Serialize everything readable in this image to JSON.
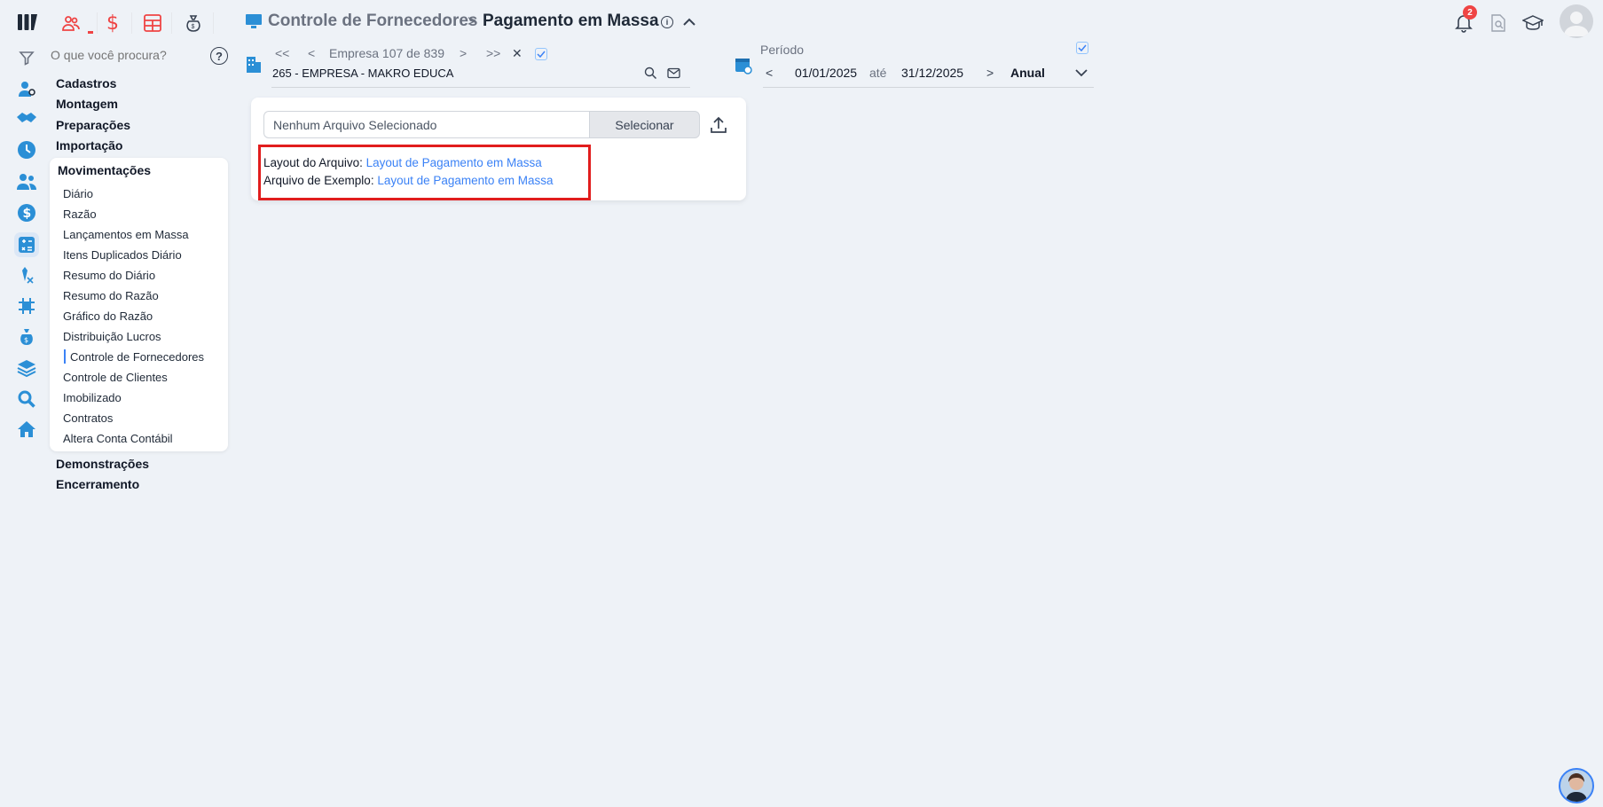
{
  "header": {
    "breadcrumb_parent": "Controle de Fornecedores",
    "breadcrumb_separator": ">",
    "page_title": "Pagamento em Massa"
  },
  "search": {
    "placeholder": "O que você procura?"
  },
  "sidebar": {
    "sections": [
      {
        "label": "Cadastros"
      },
      {
        "label": "Montagem"
      },
      {
        "label": "Preparações"
      },
      {
        "label": "Importação"
      }
    ],
    "submenu_title": "Movimentações",
    "submenu_items": [
      {
        "label": "Diário"
      },
      {
        "label": "Razão"
      },
      {
        "label": "Lançamentos em Massa"
      },
      {
        "label": "Itens Duplicados Diário"
      },
      {
        "label": "Resumo do Diário"
      },
      {
        "label": "Resumo do Razão"
      },
      {
        "label": "Gráfico do Razão"
      },
      {
        "label": "Distribuição Lucros"
      },
      {
        "label": "Controle de Fornecedores",
        "active": true
      },
      {
        "label": "Controle de Clientes"
      },
      {
        "label": "Imobilizado"
      },
      {
        "label": "Contratos"
      },
      {
        "label": "Altera Conta Contábil"
      }
    ],
    "after_sections": [
      {
        "label": "Demonstrações"
      },
      {
        "label": "Encerramento"
      }
    ]
  },
  "empresa": {
    "first": "<<",
    "prev": "<",
    "counter": "Empresa 107 de 839",
    "next": ">",
    "last": ">>",
    "clear": "✕",
    "name": "265 - EMPRESA - MAKRO EDUCA"
  },
  "periodo": {
    "label": "Período",
    "prev": "<",
    "start": "01/01/2025",
    "between": "até",
    "end": "31/12/2025",
    "next": ">",
    "mode": "Anual"
  },
  "upload": {
    "file_placeholder": "Nenhum Arquivo Selecionado",
    "select_label": "Selecionar",
    "layout_label": "Layout do Arquivo:",
    "layout_link": "Layout de Pagamento em Massa",
    "example_label": "Arquivo de Exemplo:",
    "example_link": "Layout de Pagamento em Massa"
  },
  "notifications": {
    "count": "2"
  },
  "colors": {
    "accent": "#3b82f6",
    "highlight": "#e11d1d",
    "top_icons": "#ef4444"
  }
}
